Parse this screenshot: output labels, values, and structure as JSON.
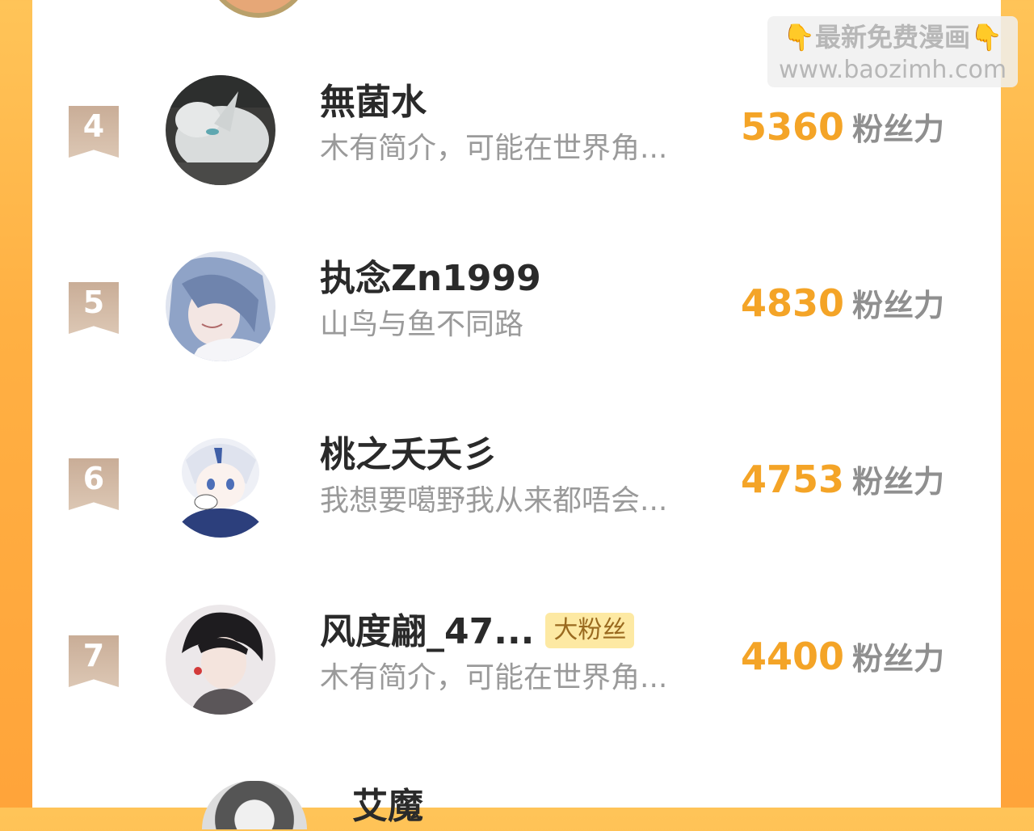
{
  "watermark": {
    "line1": "最新免费漫画",
    "line2": "www.baozimh.com",
    "hand_left": "👇",
    "hand_right": "👇"
  },
  "colors": {
    "background": "#ffb043",
    "score": "#f4a427",
    "rank_badge": "#cfb6a0",
    "fan_badge_bg": "#fde9a3"
  },
  "entries": [
    {
      "rank": "4",
      "name": "無菌水",
      "badge": "",
      "bio": "木有简介，可能在世界角...",
      "score": "5360",
      "unit": "粉丝力",
      "avatar": "white-cat-avatar"
    },
    {
      "rank": "5",
      "name": "执念Zn1999",
      "badge": "",
      "bio": "山鸟与鱼不同路",
      "score": "4830",
      "unit": "粉丝力",
      "avatar": "anime-boy-avatar"
    },
    {
      "rank": "6",
      "name": "桃之夭夭彡",
      "badge": "",
      "bio": "我想要噶野我从来都唔会...",
      "score": "4753",
      "unit": "粉丝力",
      "avatar": "anime-girl-avatar"
    },
    {
      "rank": "7",
      "name": "风度翩_47...",
      "badge": "大粉丝",
      "bio": "木有简介，可能在世界角...",
      "score": "4400",
      "unit": "粉丝力",
      "avatar": "dark-hair-boy-avatar"
    }
  ],
  "next_entry": {
    "name": "艾魔"
  }
}
